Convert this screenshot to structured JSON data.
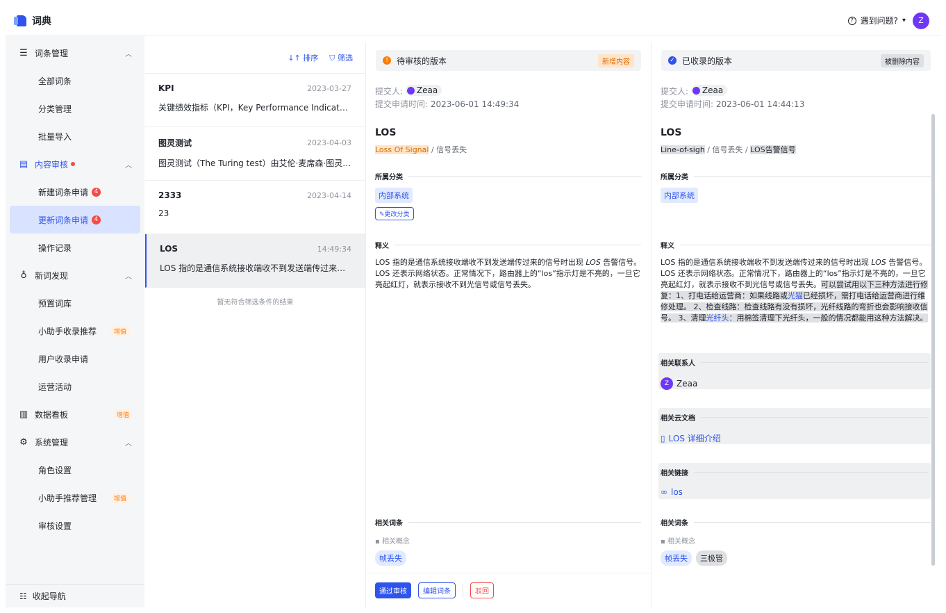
{
  "app": {
    "title": "词典",
    "help": "遇到问题?",
    "user_initial": "Z"
  },
  "sidebar": {
    "groups": [
      {
        "label": "词条管理",
        "items": [
          "全部词条",
          "分类管理",
          "批量导入"
        ]
      },
      {
        "label": "内容审核",
        "items": [
          "新建词条申请",
          "更新词条申请",
          "操作记录"
        ],
        "badges": [
          "4",
          "4"
        ]
      },
      {
        "label": "新词发现",
        "items": [
          "预置词库",
          "小助手收录推荐",
          "用户收录申请",
          "运营活动"
        ]
      },
      {
        "label": "数据看板"
      },
      {
        "label": "系统管理",
        "items": [
          "角色设置",
          "小助手推荐管理",
          "审核设置"
        ]
      }
    ],
    "pro_tag": "增值",
    "collapse": "收起导航"
  },
  "list": {
    "sort": "排序",
    "filter": "筛选",
    "rows": [
      {
        "title": "KPI",
        "date": "2023-03-27",
        "desc": "关键绩效指标（KPI，Key Performance Indicator），是"
      },
      {
        "title": "图灵测试",
        "date": "2023-04-03",
        "desc": "图灵测试（The Turing test）由艾伦·麦席森·图灵发明..."
      },
      {
        "title": "2333",
        "date": "2023-04-14",
        "desc": "23"
      },
      {
        "title": "LOS",
        "date": "14:49:34",
        "desc": "LOS 指的是通信系统接收端收不到发送端传过来的信号"
      }
    ],
    "empty": "暂无符合筛选条件的结果"
  },
  "pending": {
    "header": "待审核的版本",
    "tag": "新增内容",
    "submitter_label": "提交人:",
    "submitter": "Zeaa",
    "time_label": "提交申请时间:",
    "time": "2023-06-01 14:49:34",
    "term": "LOS",
    "alias1": "Loss Of Signal",
    "alias_sep": " / ",
    "alias2": "信号丢失",
    "cat_label": "所属分类",
    "category": "内部系统",
    "change_cat": "更改分类",
    "def_label": "释义",
    "def_a": "LOS 指的是通信系统接收端收不到发送端传过来的信号时出现 ",
    "def_i": "LOS",
    "def_b": " 告警信号。 LOS 还表示网络状态。正常情况下，路由器上的“los”指示灯是不亮的，一旦它亮起红灯，就表示接收不到光信号或信号丢失。",
    "rel_label": "相关词条",
    "rel_sub": "相关概念",
    "rel_items": [
      "帧丢失"
    ],
    "btn_approve": "通过审核",
    "btn_edit": "编辑词条",
    "btn_reject": "驳回"
  },
  "accepted": {
    "header": "已收录的版本",
    "tag": "被删除内容",
    "submitter_label": "提交人:",
    "submitter": "Zeaa",
    "time_label": "提交申请时间:",
    "time": "2023-06-01 14:44:13",
    "term": "LOS",
    "alias1": "Line-of-sigh",
    "alias2": "信号丢失",
    "alias3": "LOS告警信号",
    "cat_label": "所属分类",
    "category": "内部系统",
    "def_label": "释义",
    "def_a": "LOS 指的是通信系统接收端收不到发送端传过来的信号时出现 ",
    "def_i": "LOS",
    "def_b": " 告警信号。 LOS 还表示网络状态。正常情况下，路由器上的“los”指示灯是不亮的，一旦它亮起红灯，就表示接收不到光信号或信号丢失。",
    "def_del_a": "可以尝试用以下三种方法进行修复：1、打电话给运营商：如果线路或",
    "def_del_link1": "光猫",
    "def_del_b": "已经损坏，需打电话给运营商进行维修处理。 2、检查线路：检查线路有没有损坏，光纤线路的弯折也会影响接收信号。 3、清理",
    "def_del_link2": "光纤头",
    "def_del_c": "：用棉签清理下光纤头，一般的情况都能用这种方法解决。",
    "contact_label": "相关联系人",
    "contact": "Zeaa",
    "doc_label": "相关云文档",
    "doc": "LOS 详细介绍",
    "link_label": "相关链接",
    "link": "los",
    "rel_label": "相关词条",
    "rel_sub": "相关概念",
    "rel_items": [
      "帧丢失",
      "三极管"
    ]
  }
}
